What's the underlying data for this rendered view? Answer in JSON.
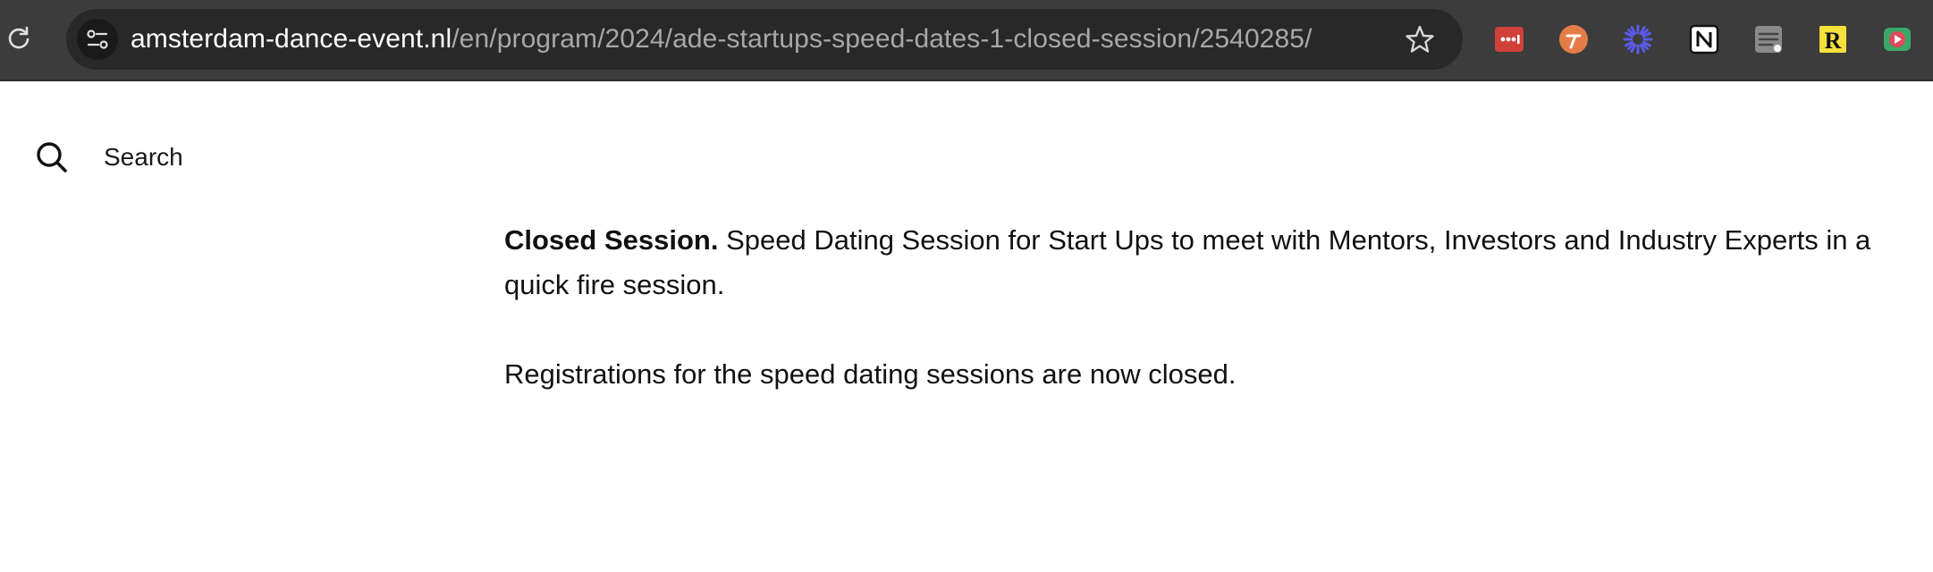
{
  "browser": {
    "url_domain": "amsterdam-dance-event.nl",
    "url_path": "/en/program/2024/ade-startups-speed-dates-1-closed-session/2540285/",
    "extensions": [
      {
        "name": "todoist-extension-icon",
        "color": "#d0413a"
      },
      {
        "name": "toggl-extension-icon",
        "color": "#e57c47"
      },
      {
        "name": "asterisk-extension-icon",
        "color": "#5a5ae6"
      },
      {
        "name": "notion-extension-icon",
        "color": "#ffffff"
      },
      {
        "name": "stack-extension-icon",
        "color": "#8a8a8a"
      },
      {
        "name": "r-extension-icon",
        "color": "#f5e13b"
      },
      {
        "name": "video-extension-icon",
        "color": "#3aa86b"
      }
    ]
  },
  "page": {
    "search_label": "Search",
    "lead_bold": "Closed Session.",
    "lead_text": " Speed Dating Session for Start Ups to meet with Mentors, Investors and Industry Experts in a quick fire session.",
    "notice": "Registrations for the speed dating sessions are now closed."
  },
  "colors": {
    "toolbar_bg": "#3c3c3c",
    "omnibox_bg": "#282828",
    "text": "#111111"
  }
}
